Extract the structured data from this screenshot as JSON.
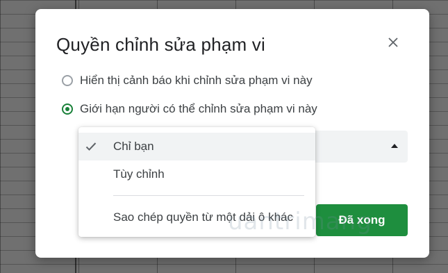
{
  "dialog": {
    "title": "Quyền chỉnh sửa phạm vi",
    "close_icon": "close-icon"
  },
  "options": [
    {
      "label": "Hiển thị cảnh báo khi chỉnh sửa phạm vi này",
      "checked": false
    },
    {
      "label": "Giới hạn người có thể chỉnh sửa phạm vi này",
      "checked": true
    }
  ],
  "dropdown": {
    "items": [
      {
        "label": "Chỉ bạn",
        "selected": true
      },
      {
        "label": "Tùy chỉnh",
        "selected": false
      },
      {
        "label": "Sao chép quyền từ một dải ô khác",
        "selected": false
      }
    ]
  },
  "buttons": {
    "done_label": "Đã xong"
  },
  "colors": {
    "accent": "#1e8e3e",
    "radio_checked": "#188038"
  },
  "watermark": "uantrimang"
}
